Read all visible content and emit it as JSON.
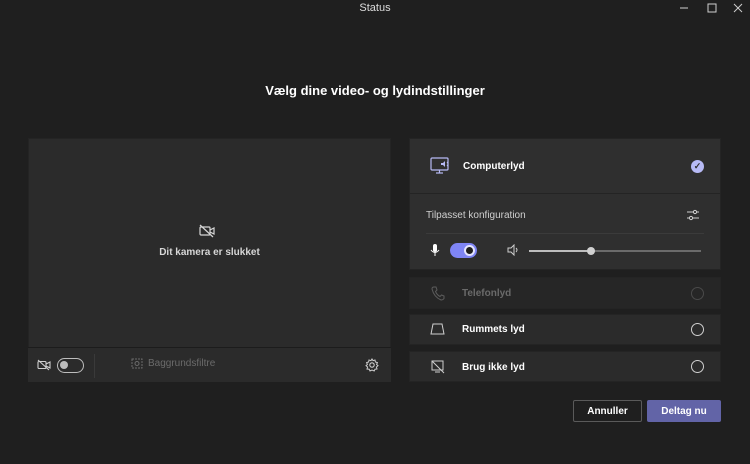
{
  "window": {
    "title": "Status"
  },
  "heading": "Vælg dine video- og lydindstillinger",
  "video": {
    "camera_off_text": "Dit kamera er slukket",
    "camera_toggle_on": false,
    "background_filters_label": "Baggrundsfiltre"
  },
  "audio": {
    "options": [
      {
        "label": "Computerlyd",
        "selected": true
      },
      {
        "label": "Telefonlyd",
        "selected": false,
        "disabled": true
      },
      {
        "label": "Rummets lyd",
        "selected": false
      },
      {
        "label": "Brug ikke lyd",
        "selected": false
      }
    ],
    "custom_config_label": "Tilpasset konfiguration",
    "mic_on": true,
    "speaker_volume": 0.36
  },
  "buttons": {
    "cancel": "Annuller",
    "join": "Deltag nu"
  },
  "colors": {
    "accent": "#6264a7",
    "toggle_on": "#7f85f5",
    "background": "#1f1f1f"
  }
}
